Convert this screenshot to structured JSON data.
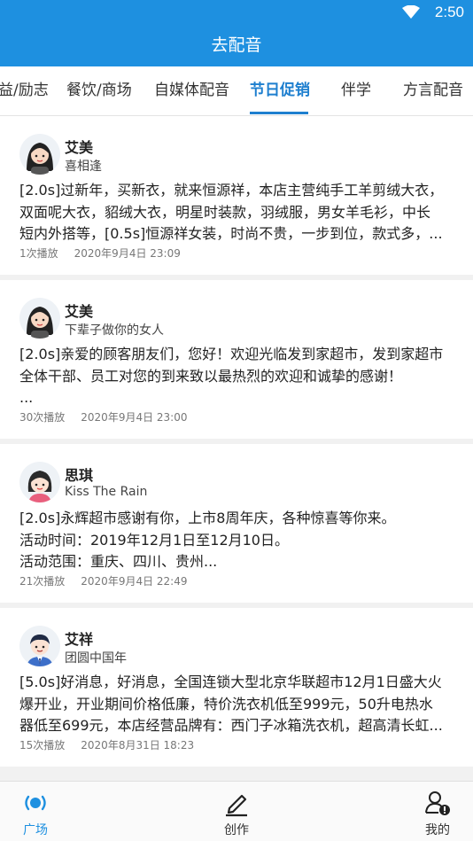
{
  "status_bar": {
    "time": "2:50",
    "wifi_icon": "wifi-icon"
  },
  "app_bar": {
    "title": "去配音"
  },
  "tabs": [
    {
      "label": "益/励志"
    },
    {
      "label": "餐饮/商场"
    },
    {
      "label": "自媒体配音"
    },
    {
      "label": "节日促销",
      "active": true
    },
    {
      "label": "伴学"
    },
    {
      "label": "方言配音"
    }
  ],
  "colors": {
    "primary": "#1e90e0",
    "tab_active": "#1e7fcf"
  },
  "items": [
    {
      "avatar": "female-avatar-icon",
      "name": "艾美",
      "subtitle": "喜相逢",
      "content": "[2.0s]过新年，买新衣，就来恒源祥，本店主营纯手工羊剪绒大衣，\n双面呢大衣，貂绒大衣，明星时装款，羽绒服，男女羊毛衫，中长\n短内外搭等，[0.5s]恒源祥女装，时尚不贵，一步到位，款式多，...",
      "plays": "1次播放",
      "date": "2020年9月4日 23:09"
    },
    {
      "avatar": "female-avatar-icon",
      "name": "艾美",
      "subtitle": "下辈子做你的女人",
      "content": "[2.0s]亲爱的顾客朋友们，您好！欢迎光临发到家超市，发到家超市\n全体干部、员工对您的到来致以最热烈的欢迎和诚挚的感谢！\n...",
      "plays": "30次播放",
      "date": "2020年9月4日 23:00"
    },
    {
      "avatar": "girl-avatar-icon",
      "name": "思琪",
      "subtitle": "Kiss The Rain",
      "content": "[2.0s]永辉超市感谢有你，上市8周年庆，各种惊喜等你来。\n活动时间：2019年12月1日至12月10日。\n活动范围：重庆、四川、贵州...",
      "plays": "21次播放",
      "date": "2020年9月4日 22:49"
    },
    {
      "avatar": "male-avatar-icon",
      "name": "艾祥",
      "subtitle": "团圆中国年",
      "content": "[5.0s]好消息，好消息，全国连锁大型北京华联超市12月1日盛大火\n爆开业，开业期间价格低廉，特价洗衣机低至999元，50升电热水\n器低至699元，本店经营品牌有：西门子冰箱洗衣机，超高清长虹...",
      "plays": "15次播放",
      "date": "2020年8月31日 18:23"
    }
  ],
  "bottom_nav": [
    {
      "label": "广场",
      "icon": "broadcast-icon",
      "active": true
    },
    {
      "label": "创作",
      "icon": "pen-icon"
    },
    {
      "label": "我的",
      "icon": "user-icon"
    }
  ]
}
